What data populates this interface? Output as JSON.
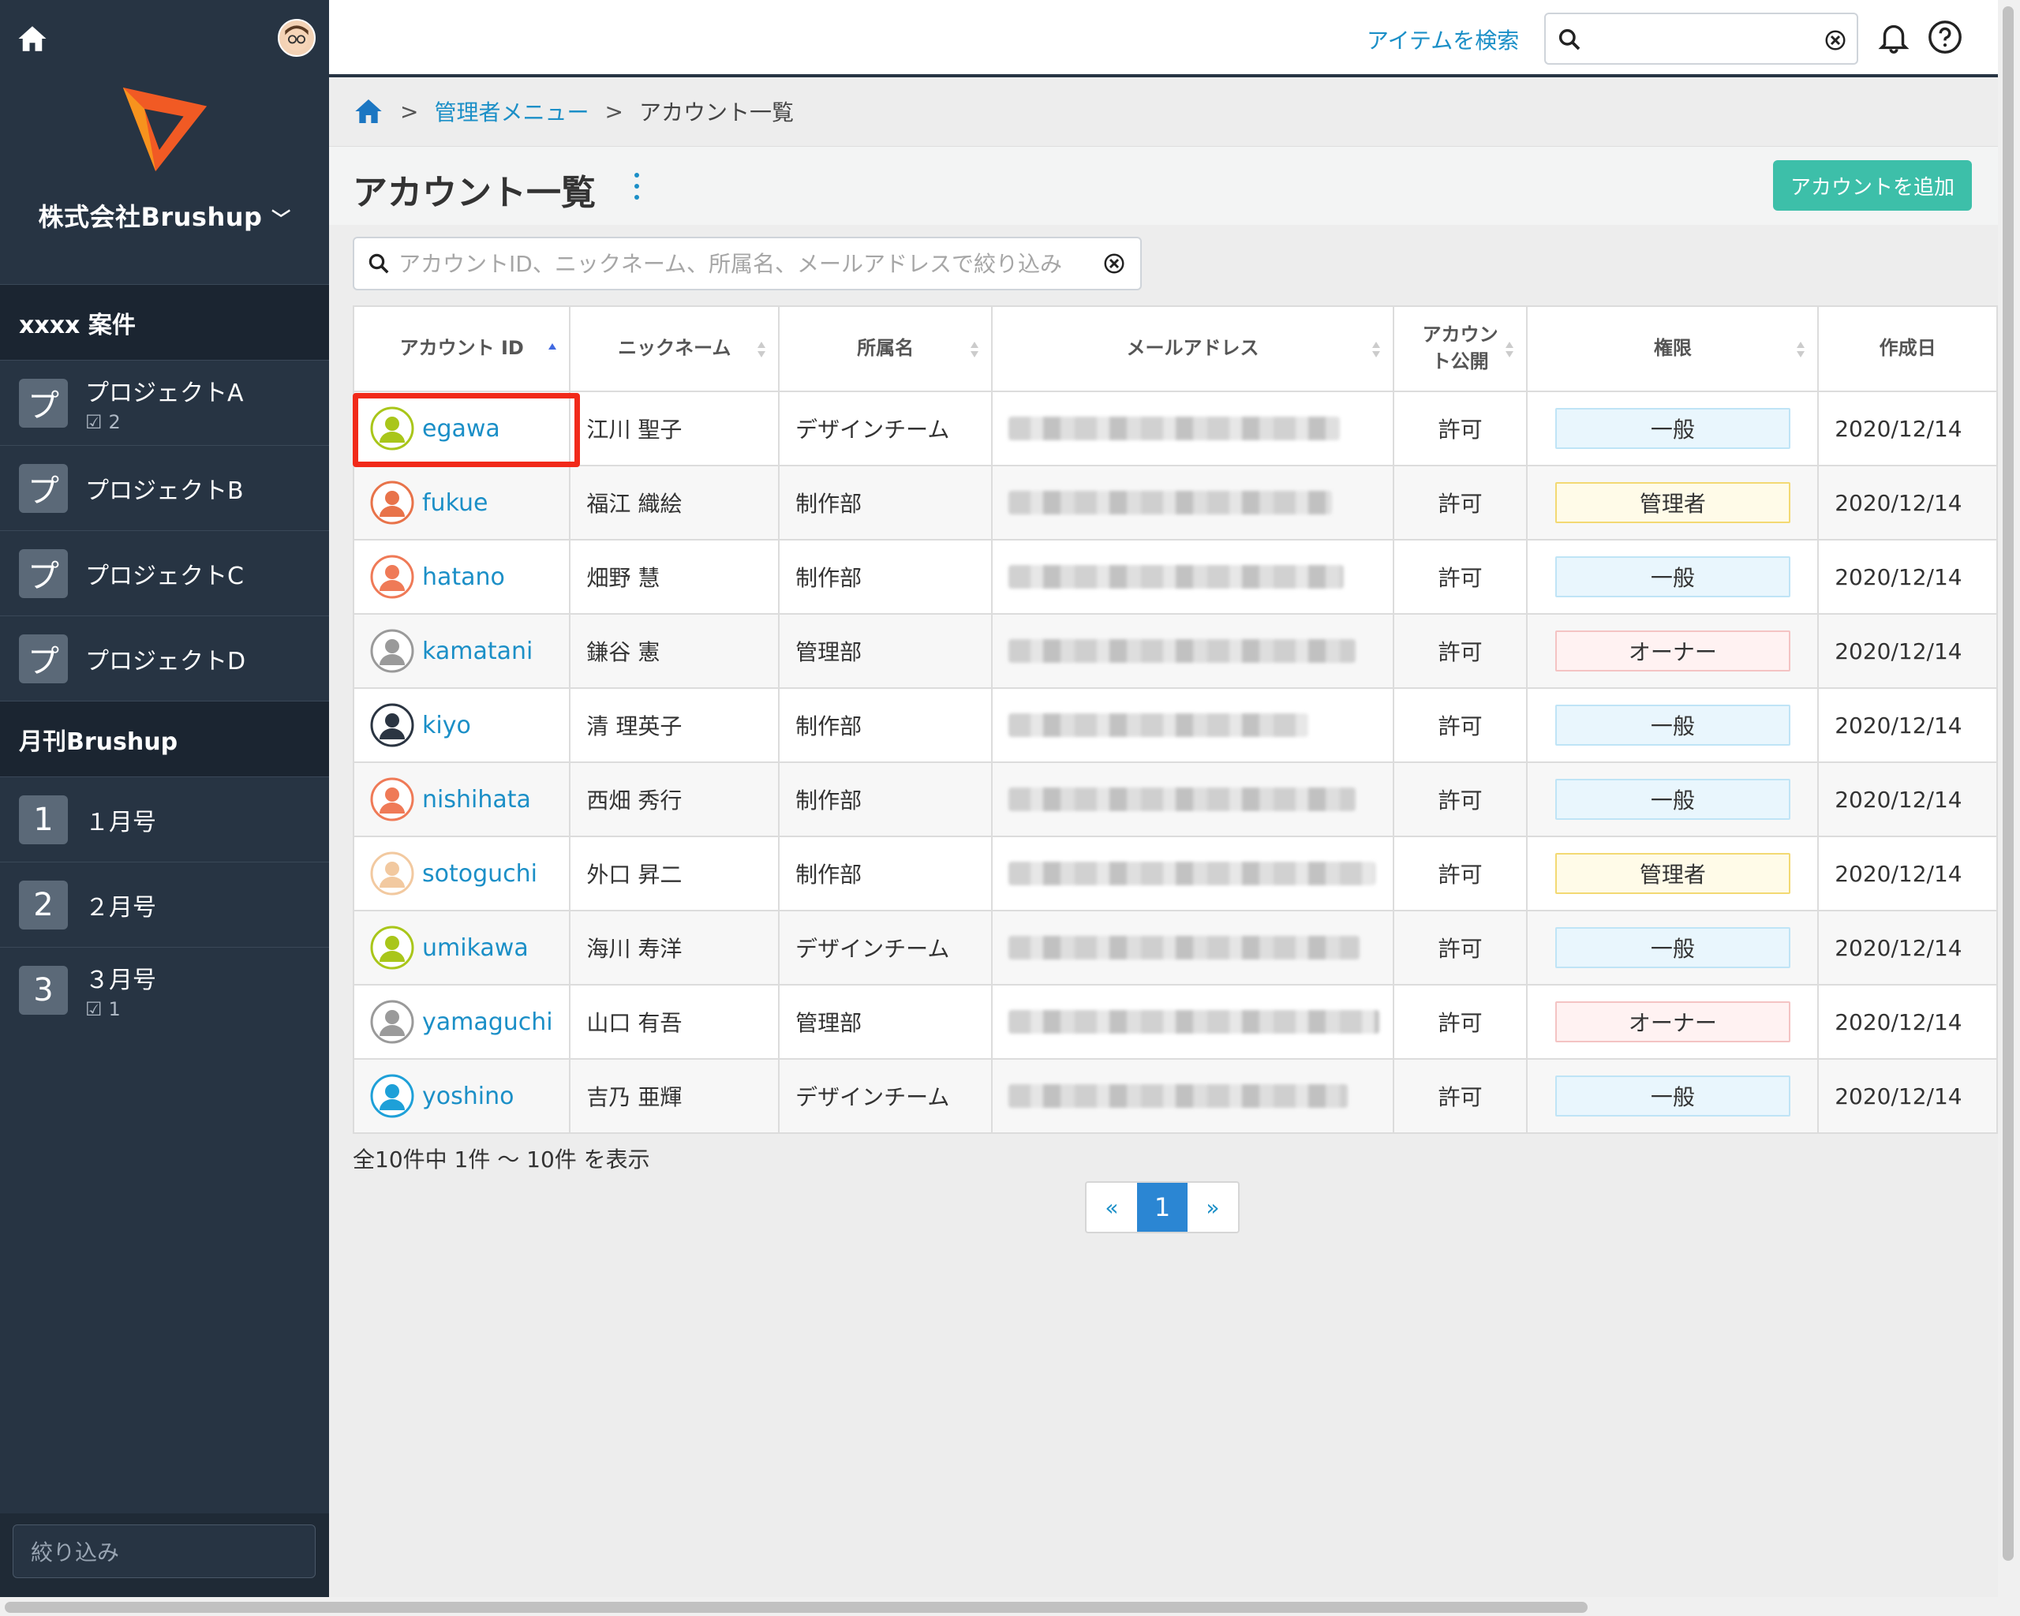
{
  "sidebar": {
    "company": "株式会社Brushup",
    "sections": [
      {
        "title": "xxxx 案件",
        "items": [
          {
            "badge": "プ",
            "label": "プロジェクトA",
            "count": "2"
          },
          {
            "badge": "プ",
            "label": "プロジェクトB",
            "count": ""
          },
          {
            "badge": "プ",
            "label": "プロジェクトC",
            "count": ""
          },
          {
            "badge": "プ",
            "label": "プロジェクトD",
            "count": ""
          }
        ]
      },
      {
        "title": "月刊Brushup",
        "items": [
          {
            "badge": "1",
            "label": "１月号",
            "count": ""
          },
          {
            "badge": "2",
            "label": "２月号",
            "count": ""
          },
          {
            "badge": "3",
            "label": "３月号",
            "count": "1"
          }
        ]
      }
    ],
    "filter_placeholder": "絞り込み"
  },
  "header": {
    "search_label": "アイテムを検索",
    "search_value": ""
  },
  "breadcrumb": {
    "sep": ">",
    "admin_menu": "管理者メニュー",
    "current": "アカウント一覧"
  },
  "page": {
    "title": "アカウント一覧",
    "add_button": "アカウントを追加",
    "filter_placeholder": "アカウントID、ニックネーム、所属名、メールアドレスで絞り込み"
  },
  "table": {
    "headers": [
      "アカウント ID",
      "ニックネーム",
      "所属名",
      "メールアドレス",
      "アカウント公開",
      "権限",
      "作成日"
    ],
    "rows": [
      {
        "id": "egawa",
        "nickname": "江川 聖子",
        "dept": "デザインチーム",
        "public": "許可",
        "role": "一般",
        "role_type": "general",
        "created": "2020/12/14",
        "avatar_color": "#a9c61a"
      },
      {
        "id": "fukue",
        "nickname": "福江 織絵",
        "dept": "制作部",
        "public": "許可",
        "role": "管理者",
        "role_type": "admin",
        "created": "2020/12/14",
        "avatar_color": "#e8734a"
      },
      {
        "id": "hatano",
        "nickname": "畑野 慧",
        "dept": "制作部",
        "public": "許可",
        "role": "一般",
        "role_type": "general",
        "created": "2020/12/14",
        "avatar_color": "#ef7a57"
      },
      {
        "id": "kamatani",
        "nickname": "鎌谷 憲",
        "dept": "管理部",
        "public": "許可",
        "role": "オーナー",
        "role_type": "owner",
        "created": "2020/12/14",
        "avatar_color": "#9a9a9a"
      },
      {
        "id": "kiyo",
        "nickname": "清 理英子",
        "dept": "制作部",
        "public": "許可",
        "role": "一般",
        "role_type": "general",
        "created": "2020/12/14",
        "avatar_color": "#2b3542"
      },
      {
        "id": "nishihata",
        "nickname": "西畑 秀行",
        "dept": "制作部",
        "public": "許可",
        "role": "一般",
        "role_type": "general",
        "created": "2020/12/14",
        "avatar_color": "#ef7a57"
      },
      {
        "id": "sotoguchi",
        "nickname": "外口 昇二",
        "dept": "制作部",
        "public": "許可",
        "role": "管理者",
        "role_type": "admin",
        "created": "2020/12/14",
        "avatar_color": "#f2c9a0"
      },
      {
        "id": "umikawa",
        "nickname": "海川 寿洋",
        "dept": "デザインチーム",
        "public": "許可",
        "role": "一般",
        "role_type": "general",
        "created": "2020/12/14",
        "avatar_color": "#a9c61a"
      },
      {
        "id": "yamaguchi",
        "nickname": "山口 有吾",
        "dept": "管理部",
        "public": "許可",
        "role": "オーナー",
        "role_type": "owner",
        "created": "2020/12/14",
        "avatar_color": "#9a9a9a"
      },
      {
        "id": "yoshino",
        "nickname": "吉乃 亜輝",
        "dept": "デザインチーム",
        "public": "許可",
        "role": "一般",
        "role_type": "general",
        "created": "2020/12/14",
        "avatar_color": "#1ea0d8"
      }
    ]
  },
  "summary": "全10件中 1件 〜 10件 を表示",
  "pagination": {
    "prev": "«",
    "current": "1",
    "next": "»"
  },
  "colors": {
    "sidebar": "#273443",
    "accent": "#3dbfa9",
    "link": "#1b8fc7",
    "highlight": "#f12a1a"
  }
}
